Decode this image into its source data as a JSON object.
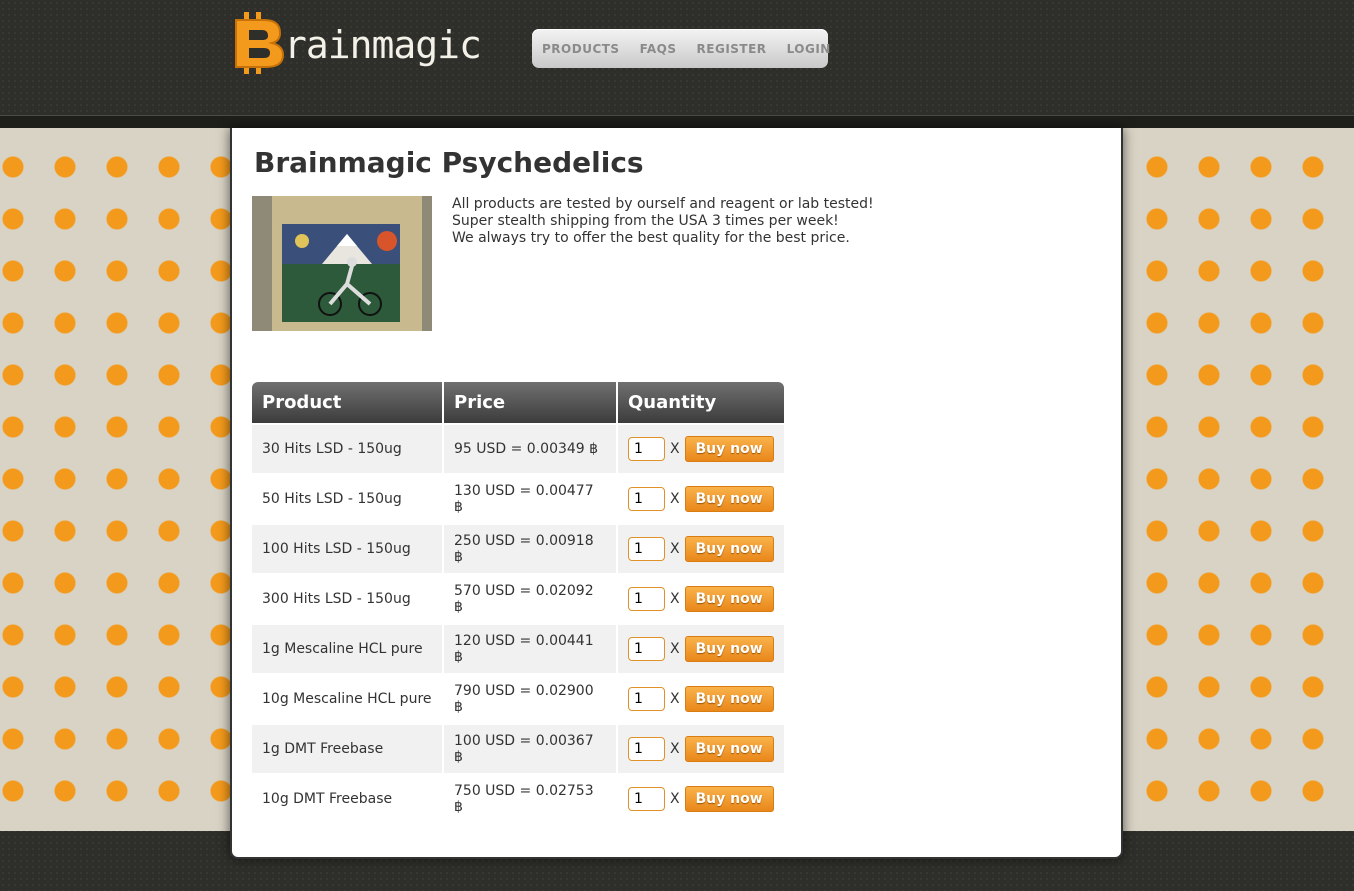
{
  "site": {
    "logo_text": "rainmagic",
    "logo_icon": "bitcoin-b-icon"
  },
  "nav": [
    {
      "label": "PRODUCTS"
    },
    {
      "label": "FAQS"
    },
    {
      "label": "REGISTER"
    },
    {
      "label": "LOGIN"
    }
  ],
  "page": {
    "title": "Brainmagic Psychedelics",
    "intro": [
      "All products are tested by ourself and reagent or lab tested!",
      "Super stealth shipping from the USA 3 times per week!",
      "We always try to offer the best quality for the best price."
    ]
  },
  "table": {
    "headers": [
      "Product",
      "Price",
      "Quantity"
    ],
    "x_label": "X",
    "buy_label": "Buy now",
    "rows": [
      {
        "product": "30 Hits LSD - 150ug",
        "price": "95 USD = 0.00349 ฿",
        "qty": "1"
      },
      {
        "product": "50 Hits LSD - 150ug",
        "price": "130 USD = 0.00477 ฿",
        "qty": "1"
      },
      {
        "product": "100 Hits LSD - 150ug",
        "price": "250 USD = 0.00918 ฿",
        "qty": "1"
      },
      {
        "product": "300 Hits LSD - 150ug",
        "price": "570 USD = 0.02092 ฿",
        "qty": "1"
      },
      {
        "product": "1g Mescaline HCL pure",
        "price": "120 USD = 0.00441 ฿",
        "qty": "1"
      },
      {
        "product": "10g Mescaline HCL pure",
        "price": "790 USD = 0.02900 ฿",
        "qty": "1"
      },
      {
        "product": "1g DMT Freebase",
        "price": "100 USD = 0.00367 ฿",
        "qty": "1"
      },
      {
        "product": "10g DMT Freebase",
        "price": "750 USD = 0.02753 ฿",
        "qty": "1"
      }
    ]
  },
  "colors": {
    "accent": "#f39a1c",
    "header_bg": "#2e2f2a"
  }
}
